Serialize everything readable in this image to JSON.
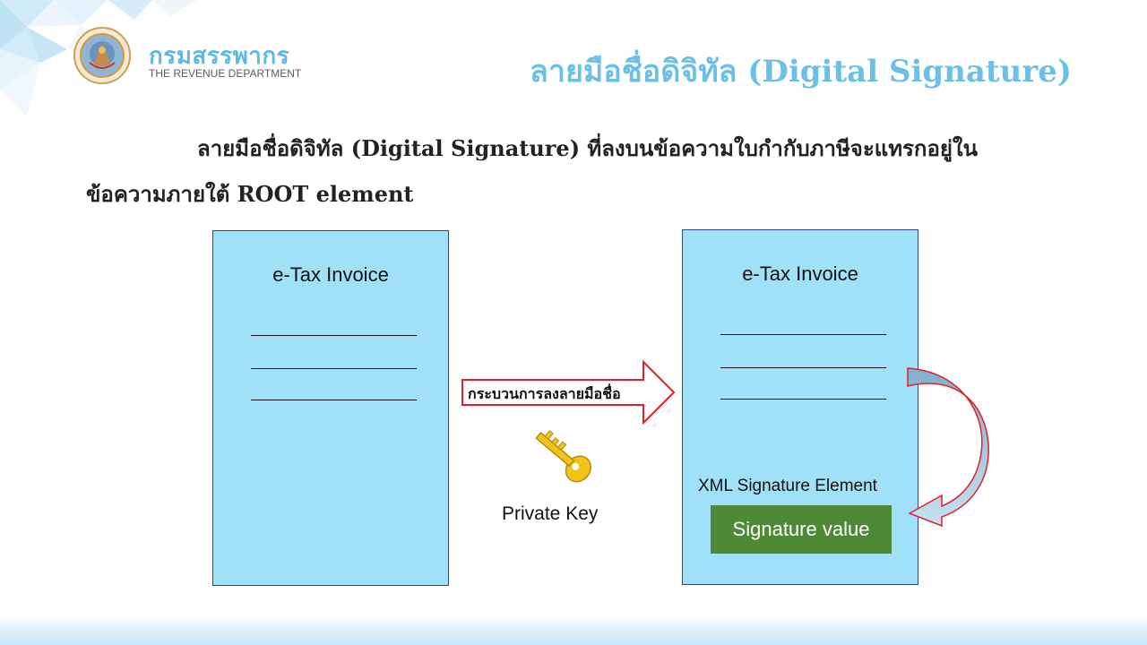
{
  "header": {
    "org_name_thai": "กรมสรรพากร",
    "org_name_english": "THE REVENUE DEPARTMENT",
    "title": "ลายมือชื่อดิจิทัล (Digital Signature)"
  },
  "description": {
    "line1": "ลายมือชื่อดิจิทัล (Digital Signature) ที่ลงบนข้อความใบกำกับภาษีจะแทรกอยู่ใน",
    "line2": "ข้อความภายใต้ ROOT element"
  },
  "diagram": {
    "left_document": {
      "title": "e-Tax Invoice"
    },
    "right_document": {
      "title": "e-Tax Invoice",
      "signature_element_label": "XML Signature Element",
      "signature_value": "Signature value"
    },
    "process_label": "กระบวนการลงลายมือชื่อ",
    "key_label": "Private Key"
  },
  "icons": {
    "seal": "revenue-department-seal-icon",
    "key": "key-icon"
  },
  "colors": {
    "title": "#6cc0e6",
    "document_fill": "#a1e1f7",
    "document_border": "#33458a",
    "signature_fill": "#4e8a35",
    "arrow_border": "#e2202a",
    "key": "#f2c31a"
  }
}
